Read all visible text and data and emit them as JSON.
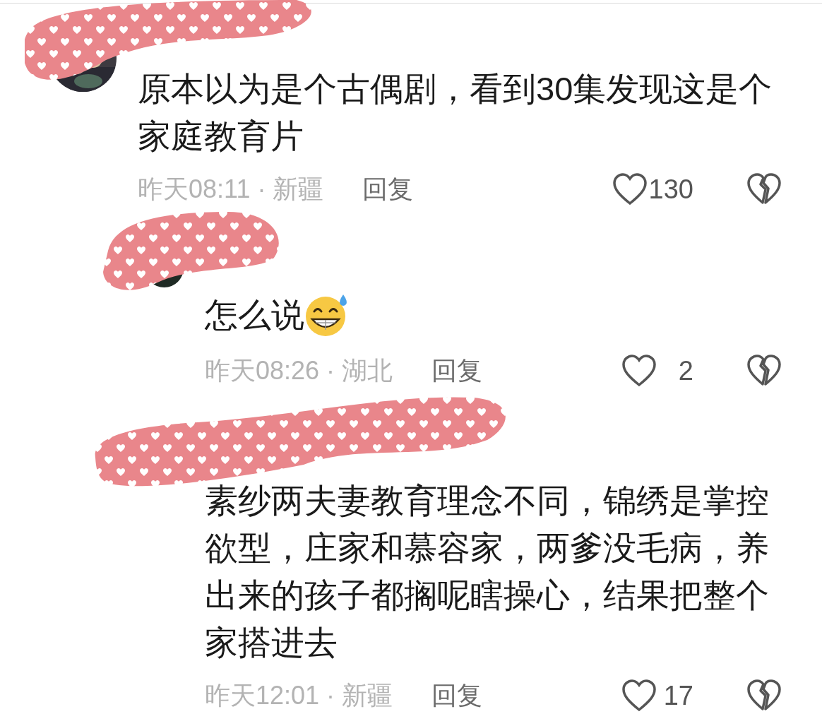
{
  "comments": [
    {
      "text": "原本以为是个古偶剧，看到30集发现这是个家庭教育片",
      "meta": "昨天08:11 · 新疆",
      "reply_label": "回复",
      "likes": "130",
      "liked": false,
      "replies": [
        {
          "text": "怎么说",
          "has_emoji": true,
          "meta": "昨天08:26 · 湖北",
          "reply_label": "回复",
          "likes": "2",
          "liked": false
        },
        {
          "text": "素纱两夫妻教育理念不同，锦绣是掌控欲型，庄家和慕容家，两爹没毛病，养出来的孩子都搁呢瞎操心，结果把整个家搭进去",
          "has_emoji": false,
          "meta": "昨天12:01 · 新疆",
          "reply_label": "回复",
          "likes": "17",
          "liked": false
        }
      ]
    }
  ]
}
